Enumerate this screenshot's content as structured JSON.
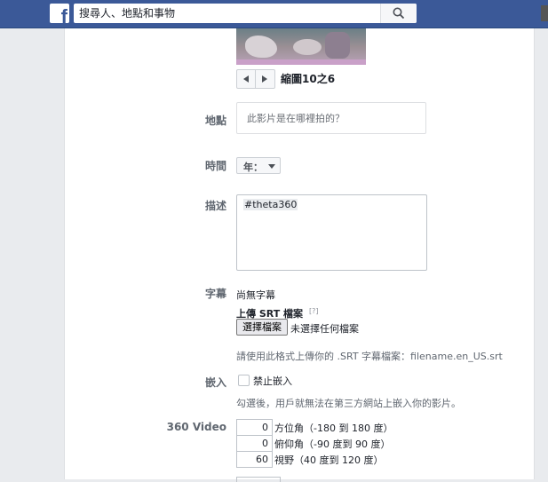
{
  "header": {
    "logo_letter": "f",
    "search_placeholder": "搜尋人、地點和事物"
  },
  "thumbnail": {
    "counter": "縮圖10之6"
  },
  "form": {
    "location": {
      "label": "地點",
      "placeholder": "此影片是在哪裡拍的？"
    },
    "time": {
      "label": "時間",
      "year_value": "年："
    },
    "description": {
      "label": "描述",
      "value": "#theta360"
    },
    "captions": {
      "label": "字幕",
      "none_text": "尚無字幕",
      "upload_label": "上傳 SRT 檔案",
      "help_marker": "[?]",
      "choose_button": "選擇檔案",
      "no_file_text": "未選擇任何檔案",
      "format_hint": "請使用此格式上傳你的 .SRT 字幕檔案：filename.en_US.srt"
    },
    "embed": {
      "label": "嵌入",
      "option": "禁止嵌入",
      "checked": false,
      "hint": "勾選後，用戶就無法在第三方網站上嵌入你的影片。"
    },
    "video360": {
      "label": "360 Video",
      "fields": [
        {
          "value": "0",
          "label": "方位角（-180 到 180 度）"
        },
        {
          "value": "0",
          "label": "俯仰角（-90 度到 90 度）"
        },
        {
          "value": "60",
          "label": "視野（40 度到 120 度）"
        }
      ]
    }
  }
}
